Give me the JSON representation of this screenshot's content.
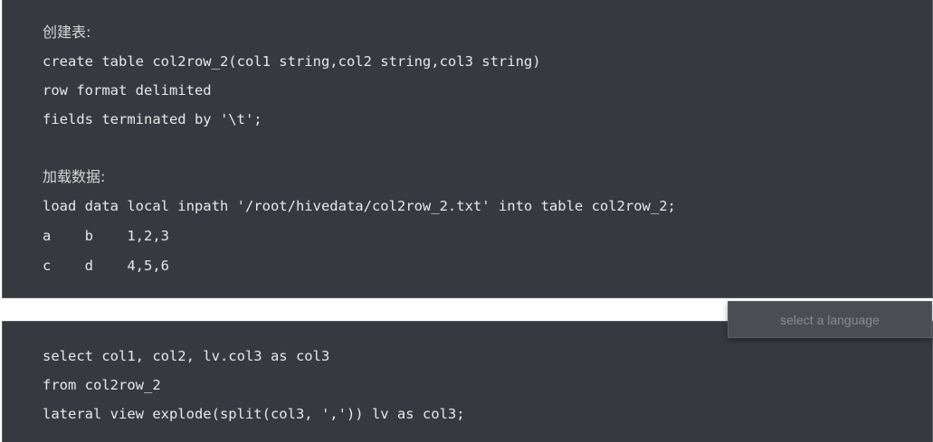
{
  "block1": {
    "lines": [
      "创建表:",
      "create table col2row_2(col1 string,col2 string,col3 string)",
      "row format delimited",
      "fields terminated by '\\t';",
      "",
      "加载数据:",
      "load data local inpath '/root/hivedata/col2row_2.txt' into table col2row_2;",
      "a    b    1,2,3",
      "c    d    4,5,6"
    ]
  },
  "block2": {
    "lines": [
      "select col1, col2, lv.col3 as col3",
      "from col2row_2",
      "lateral view explode(split(col3, ',')) lv as col3;"
    ]
  },
  "language_selector": {
    "placeholder": "select a language"
  },
  "colors": {
    "code_background": "#363a40",
    "code_text": "#e8e8e8",
    "selector_background": "#4a4e54",
    "selector_text": "#8a8e94"
  }
}
